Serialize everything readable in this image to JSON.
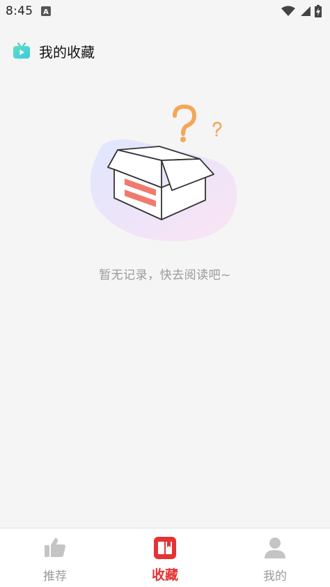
{
  "status_bar": {
    "time": "8:45",
    "icons": [
      "notification-a-icon",
      "wifi-icon",
      "signal-icon",
      "battery-charging-icon"
    ]
  },
  "header": {
    "title": "我的收藏",
    "logo_icon": "tv-icon"
  },
  "empty_state": {
    "message": "暂无记录，快去阅读吧~",
    "illustration": "empty-box-question-icon"
  },
  "bottom_nav": {
    "items": [
      {
        "label": "推荐",
        "icon": "thumbs-up-icon",
        "active": false
      },
      {
        "label": "收藏",
        "icon": "bookmark-book-icon",
        "active": true
      },
      {
        "label": "我的",
        "icon": "user-icon",
        "active": false
      }
    ]
  },
  "colors": {
    "accent": "#e33333",
    "inactive": "#9a9a9a",
    "background": "#f5f5f5",
    "box_stripe": "#f07a6e",
    "question_mark": "#f4a65a"
  }
}
